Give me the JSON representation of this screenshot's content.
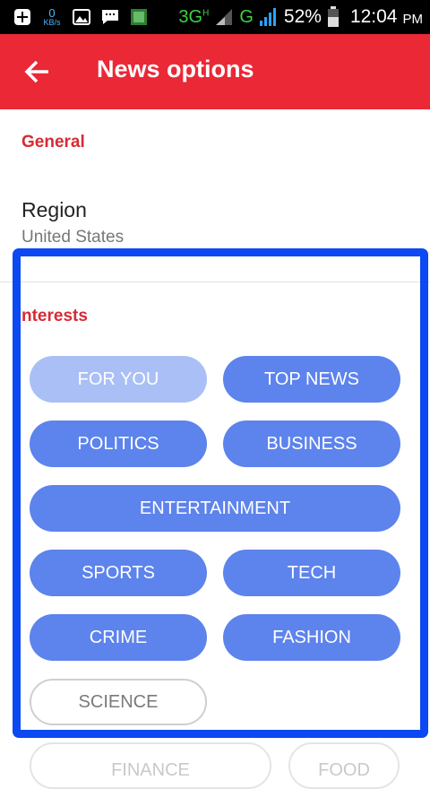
{
  "status_bar": {
    "data_speed": "0",
    "data_unit": "KB/s",
    "network_3g": "3G",
    "network_h": "H",
    "network_g": "G",
    "battery": "52%",
    "time": "12:04",
    "ampm": "PM"
  },
  "app_bar": {
    "title": "News options"
  },
  "general": {
    "header": "General",
    "region_label": "Region",
    "region_value": "United States"
  },
  "interests": {
    "header": "nterests",
    "chips": [
      "FOR YOU",
      "TOP NEWS",
      "POLITICS",
      "BUSINESS",
      "ENTERTAINMENT",
      "SPORTS",
      "TECH",
      "CRIME",
      "FASHION",
      "SCIENCE"
    ],
    "partial_chips": [
      "FINANCE",
      "FOOD"
    ]
  },
  "colors": {
    "app_bar": "#ea2836",
    "section_header": "#d62b35",
    "chip_selected": "#5d83ec",
    "chip_disabled": "#a9bff6",
    "highlight_border": "#0c49f2"
  }
}
